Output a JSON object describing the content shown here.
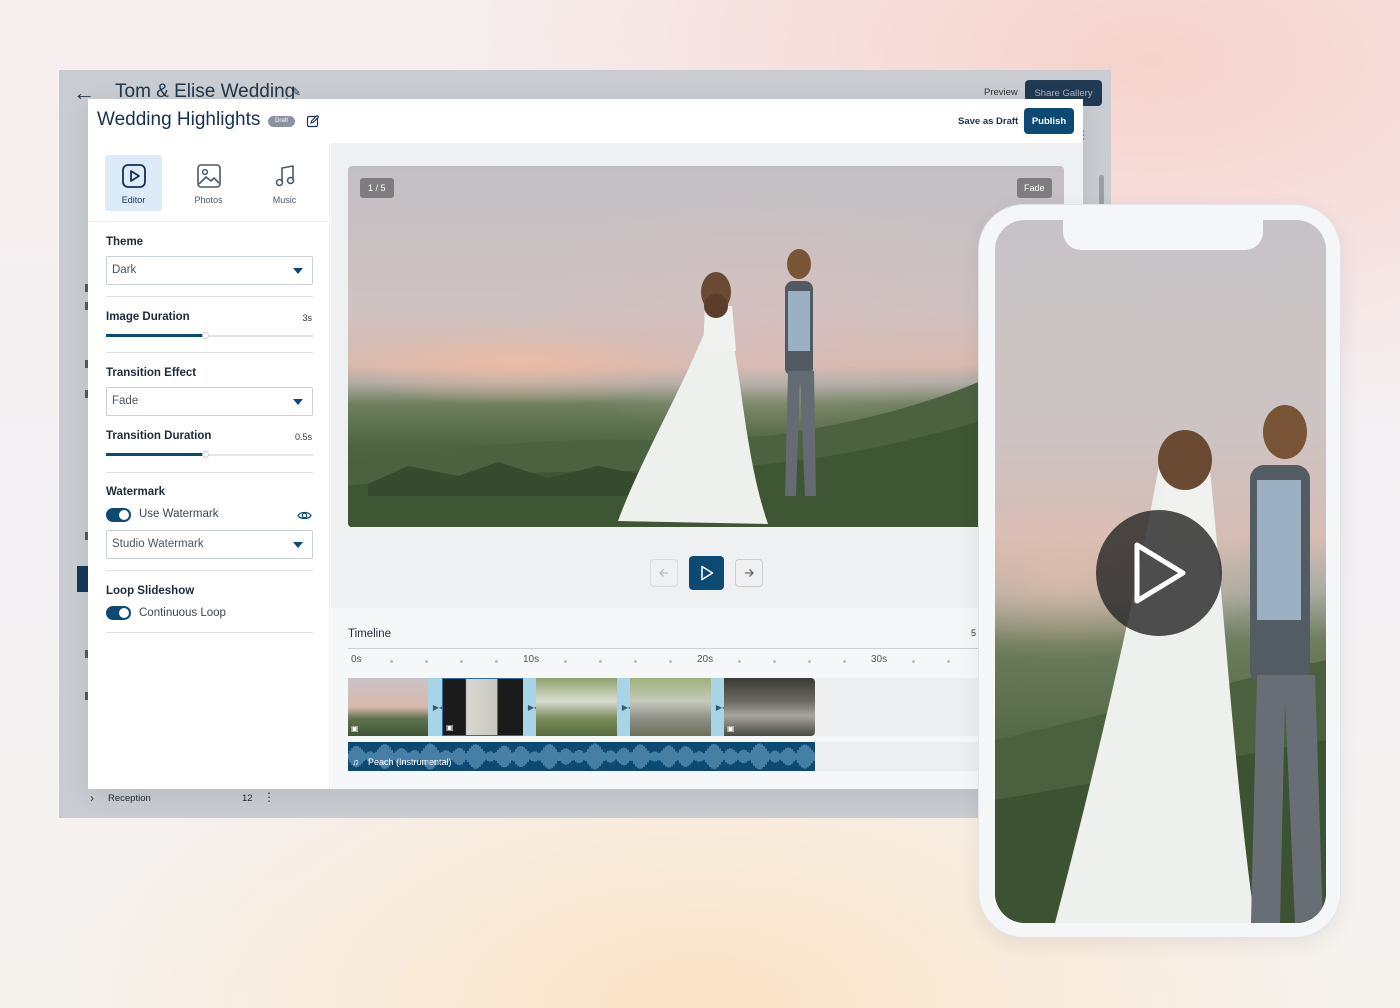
{
  "background_window": {
    "title": "Tom & Elise Wedding",
    "preview_label": "Preview",
    "share_label": "Share Gallery",
    "sidebar_row": {
      "label": "Reception",
      "count": "12"
    }
  },
  "modal": {
    "title": "Wedding Highlights",
    "status_badge": "Draft",
    "save_draft_label": "Save as Draft",
    "publish_label": "Publish"
  },
  "tabs": [
    {
      "label": "Editor",
      "icon": "play-square-icon",
      "active": true
    },
    {
      "label": "Photos",
      "icon": "image-icon",
      "active": false
    },
    {
      "label": "Music",
      "icon": "music-note-icon",
      "active": false
    }
  ],
  "settings": {
    "theme": {
      "label": "Theme",
      "value": "Dark"
    },
    "image_duration": {
      "label": "Image Duration",
      "value": "3s",
      "fill_percent": 48
    },
    "transition_effect": {
      "label": "Transition Effect",
      "value": "Fade"
    },
    "transition_duration": {
      "label": "Transition Duration",
      "value": "0.5s",
      "fill_percent": 48
    },
    "watermark": {
      "label": "Watermark",
      "toggle_label": "Use Watermark",
      "enabled": true,
      "selected": "Studio Watermark"
    },
    "loop": {
      "label": "Loop Slideshow",
      "toggle_label": "Continuous Loop",
      "enabled": true
    }
  },
  "preview": {
    "counter": "1 / 5",
    "effect": "Fade"
  },
  "timeline": {
    "title": "Timeline",
    "right_marker": "5",
    "ruler": [
      "0s",
      "10s",
      "20s",
      "30s"
    ],
    "audio_track": "Peach (Instrumental)"
  },
  "colors": {
    "accent": "#0d4a73",
    "title_text": "#16324f",
    "tab_active_bg": "#dcebf7",
    "transition_clip": "#a8d4e8"
  }
}
